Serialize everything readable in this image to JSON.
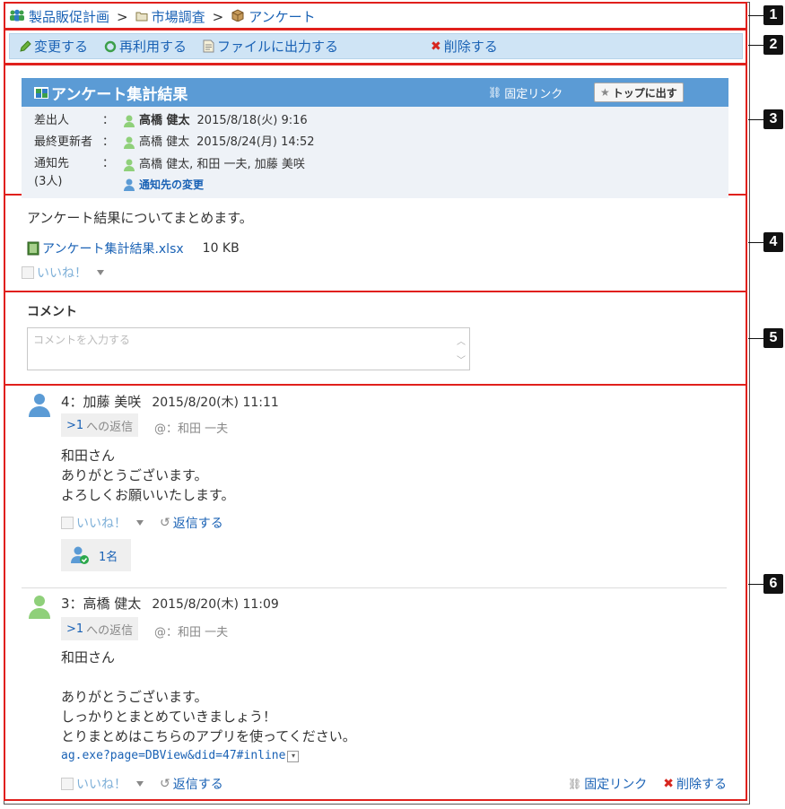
{
  "breadcrumb": {
    "root": "製品販促計画",
    "folder": "市場調査",
    "current": "アンケート",
    "separator": ">"
  },
  "toolbar": {
    "edit": "変更する",
    "reuse": "再利用する",
    "export": "ファイルに出力する",
    "delete": "削除する"
  },
  "message": {
    "title": "アンケート集計結果",
    "permalink": "固定リンク",
    "to_top": "トップに出す",
    "sender_label": "差出人",
    "sender_name": "高橋 健太",
    "sender_date": "2015/8/18(火) 9:16",
    "updater_label": "最終更新者",
    "updater_name": "高橋 健太",
    "updater_date": "2015/8/24(月) 14:52",
    "notify_label": "通知先",
    "notify_count": "(3人)",
    "notify_names": "高橋 健太, 和田 一夫, 加藤 美咲",
    "notify_change": "通知先の変更",
    "colon": "：",
    "body": "アンケート結果についてまとめます。",
    "attachment_name": "アンケート集計結果.xlsx",
    "attachment_size": "10 KB",
    "like": "いいね！"
  },
  "comment_form": {
    "title": "コメント",
    "placeholder": "コメントを入力する"
  },
  "comments": [
    {
      "header": "4：加藤 美咲",
      "date": "2015/8/20(木) 11:11",
      "reply_num": ">1",
      "reply_label": "への返信",
      "mention": "@：和田 一夫",
      "lines": [
        "和田さん",
        "ありがとうございます。",
        "よろしくお願いいたします。"
      ],
      "like": "いいね！",
      "reply_action": "返信する",
      "likers_count": "1名"
    },
    {
      "header": "3：高橋 健太",
      "date": "2015/8/20(木) 11:09",
      "reply_num": ">1",
      "reply_label": "への返信",
      "mention": "@：和田 一夫",
      "lines": [
        "和田さん",
        "",
        "ありがとうございます。",
        "しっかりとまとめていきましょう！",
        "とりまとめはこちらのアプリを使ってください。"
      ],
      "url": "ag.exe?page=DBView&did=47#inline",
      "like": "いいね！",
      "reply_action": "返信する",
      "permalink": "固定リンク",
      "delete": "削除する"
    }
  ],
  "badges": [
    "1",
    "2",
    "3",
    "4",
    "5",
    "6"
  ],
  "colors": {
    "accent": "#5b9bd5",
    "link": "#1a62b5",
    "annotation": "#e0201c",
    "toolbar_bg": "#cfe4f5"
  }
}
